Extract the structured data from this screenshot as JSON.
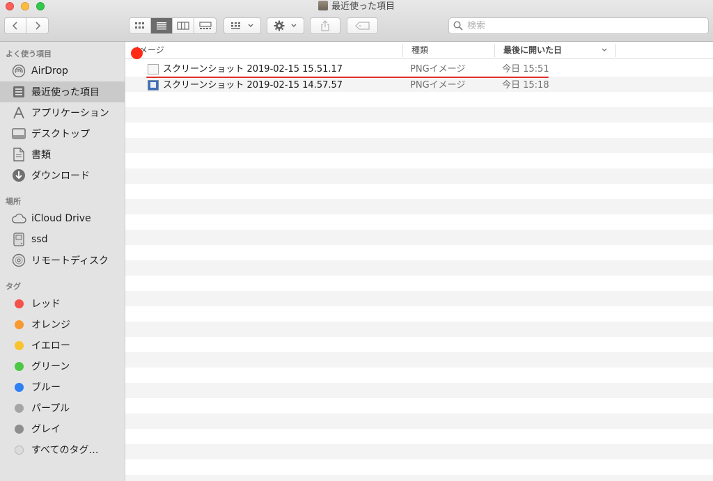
{
  "window": {
    "title": "最近使った項目"
  },
  "toolbar": {
    "back_icon": "chevron-left-icon",
    "forward_icon": "chevron-right-icon",
    "view_modes": [
      "icon-view-icon",
      "list-view-icon",
      "column-view-icon",
      "gallery-view-icon"
    ],
    "active_view": 1,
    "search_placeholder": "検索"
  },
  "sidebar": {
    "favorites_title": "よく使う項目",
    "favorites": [
      {
        "label": "AirDrop",
        "icon": "airdrop-icon"
      },
      {
        "label": "最近使った項目",
        "icon": "recents-icon",
        "selected": true
      },
      {
        "label": "アプリケーション",
        "icon": "applications-icon"
      },
      {
        "label": "デスクトップ",
        "icon": "desktop-icon"
      },
      {
        "label": "書類",
        "icon": "documents-icon"
      },
      {
        "label": "ダウンロード",
        "icon": "downloads-icon"
      }
    ],
    "places_title": "場所",
    "places": [
      {
        "label": "iCloud Drive",
        "icon": "cloud-icon"
      },
      {
        "label": "ssd",
        "icon": "disk-icon"
      },
      {
        "label": "リモートディスク",
        "icon": "optical-disc-icon"
      }
    ],
    "tags_title": "タグ",
    "tags": [
      {
        "label": "レッド",
        "color": "#f4524b"
      },
      {
        "label": "オレンジ",
        "color": "#f79a32"
      },
      {
        "label": "イエロー",
        "color": "#f8c32d"
      },
      {
        "label": "グリーン",
        "color": "#4dc845"
      },
      {
        "label": "ブルー",
        "color": "#2f80f4"
      },
      {
        "label": "パープル",
        "color": "#a5a5a5"
      },
      {
        "label": "グレイ",
        "color": "#8e8e8e"
      },
      {
        "label": "すべてのタグ…",
        "color": "#dcdcdc"
      }
    ]
  },
  "list": {
    "columns": {
      "name": "イメージ",
      "kind": "種類",
      "date": "最後に開いた日"
    },
    "rows": [
      {
        "name": "スクリーンショット 2019-02-15 15.51.17",
        "kind": "PNGイメージ",
        "date": "今日 15:51"
      },
      {
        "name": "スクリーンショット 2019-02-15 14.57.57",
        "kind": "PNGイメージ",
        "date": "今日 15:18"
      }
    ]
  },
  "annotation": {
    "color": "#ff2a17"
  }
}
